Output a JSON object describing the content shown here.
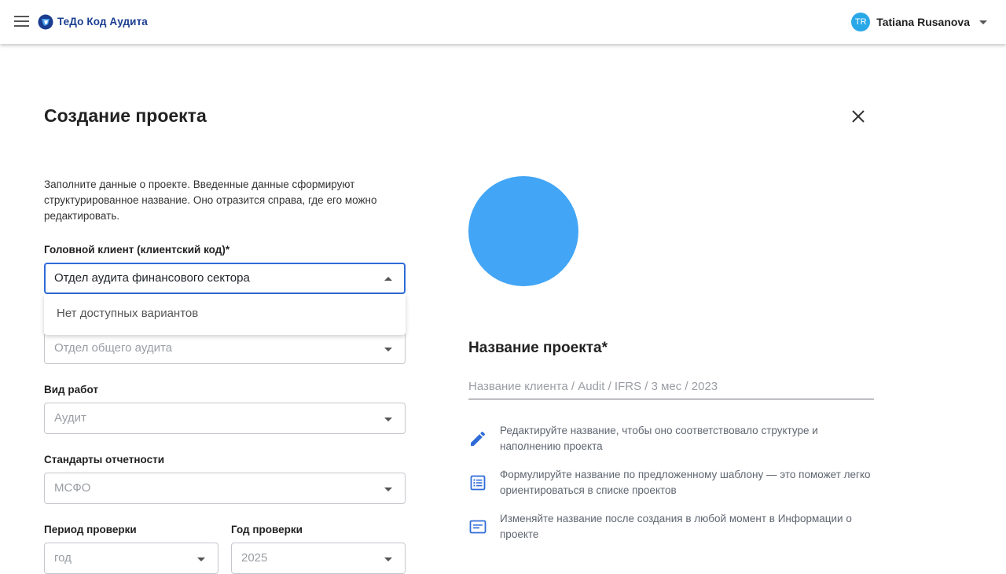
{
  "header": {
    "brand": "ТеДо Код Аудита",
    "user": {
      "initials": "TR",
      "name": "Tatiana Rusanova"
    }
  },
  "dialog": {
    "title": "Создание проекта",
    "intro": "Заполните данные о проекте. Введенные данные сформируют структурированное название. Оно отразится справа, где его можно редактировать."
  },
  "form": {
    "head_client": {
      "label": "Головной клиент (клиентский код)*",
      "value": "Отдел аудита финансового сектора",
      "no_options": "Нет доступных вариантов"
    },
    "department": {
      "placeholder": "Отдел общего аудита"
    },
    "work_type": {
      "label": "Вид работ",
      "placeholder": "Аудит"
    },
    "standards": {
      "label": "Стандарты отчетности",
      "placeholder": "МСФО"
    },
    "period": {
      "label": "Период проверки",
      "placeholder": "год"
    },
    "year": {
      "label": "Год проверки",
      "placeholder": "2025"
    }
  },
  "preview": {
    "title": "Название проекта*",
    "placeholder": "Название клиента / Audit / IFRS / 3 мес / 2023",
    "tips": [
      {
        "icon": "pencil-icon",
        "text": "Редактируйте название, чтобы оно соответствовало структуре и наполнению проекта"
      },
      {
        "icon": "list-icon",
        "text": "Формулируйте название по предложенному шаблону — это поможет легко ориентироваться в списке проектов"
      },
      {
        "icon": "info-card-icon",
        "text": "Изменяйте название после создания в любой момент в Информации о проекте"
      }
    ]
  },
  "colors": {
    "accent": "#2f6bd8",
    "brand": "#1a3d8f",
    "avatar": "#29a8e8",
    "circle": "#42a5f5"
  }
}
